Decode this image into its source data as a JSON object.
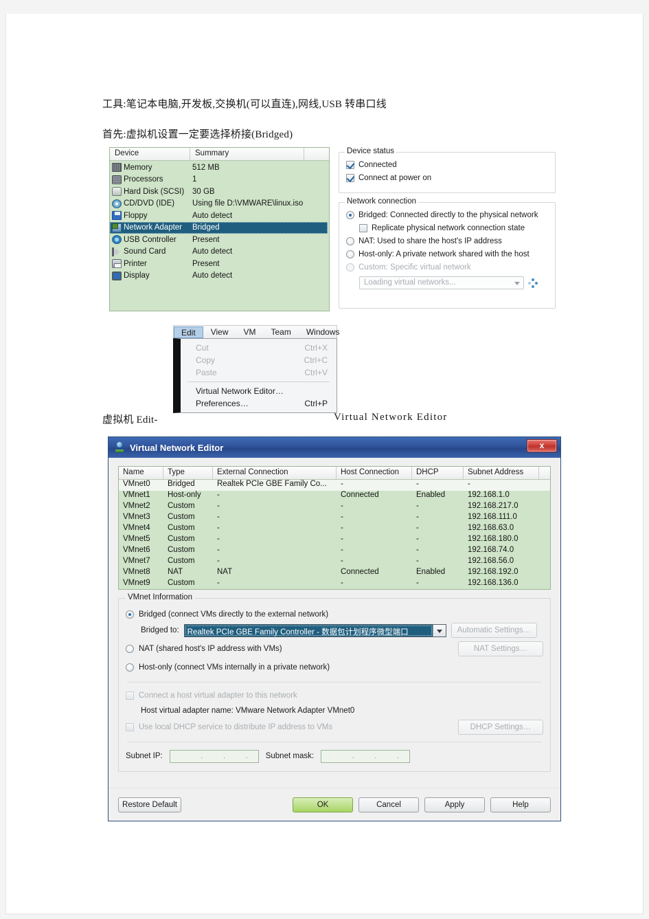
{
  "document": {
    "line1": "工具:笔记本电脑,开发板,交换机(可以直连),网线,USB 转串口线",
    "line2": "首先:虚拟机设置一定要选择桥接(Bridged)",
    "line3": "虚拟机 Edit-",
    "line4": "Virtual Network Editor"
  },
  "vm_settings": {
    "columns": [
      "Device",
      "Summary"
    ],
    "devices": [
      {
        "icon": "memory-icon",
        "name": "Memory",
        "summary": "512 MB",
        "selected": false
      },
      {
        "icon": "processor-icon",
        "name": "Processors",
        "summary": "1",
        "selected": false
      },
      {
        "icon": "hard-disk-icon",
        "name": "Hard Disk (SCSI)",
        "summary": "30 GB",
        "selected": false
      },
      {
        "icon": "cd-dvd-icon",
        "name": "CD/DVD (IDE)",
        "summary": "Using file D:\\VMWARE\\linux.iso",
        "selected": false
      },
      {
        "icon": "floppy-icon",
        "name": "Floppy",
        "summary": "Auto detect",
        "selected": false
      },
      {
        "icon": "network-adapter-icon",
        "name": "Network Adapter",
        "summary": "Bridged",
        "selected": true
      },
      {
        "icon": "usb-controller-icon",
        "name": "USB Controller",
        "summary": "Present",
        "selected": false
      },
      {
        "icon": "sound-card-icon",
        "name": "Sound Card",
        "summary": "Auto detect",
        "selected": false
      },
      {
        "icon": "printer-icon",
        "name": "Printer",
        "summary": "Present",
        "selected": false
      },
      {
        "icon": "display-icon",
        "name": "Display",
        "summary": "Auto detect",
        "selected": false
      }
    ],
    "device_status": {
      "title": "Device status",
      "connected": "Connected",
      "connect_at_power_on": "Connect at power on"
    },
    "network_connection": {
      "title": "Network connection",
      "bridged": "Bridged: Connected directly to the physical network",
      "replicate": "Replicate physical network connection state",
      "nat": "NAT: Used to share the host's IP address",
      "host_only": "Host-only: A private network shared with the host",
      "custom": "Custom: Specific virtual network",
      "custom_combo_placeholder": "Loading virtual networks..."
    }
  },
  "edit_menu": {
    "menubar": [
      "Edit",
      "View",
      "VM",
      "Team",
      "Windows"
    ],
    "items": [
      {
        "label": "Cut",
        "shortcut": "Ctrl+X",
        "disabled": true
      },
      {
        "label": "Copy",
        "shortcut": "Ctrl+C",
        "disabled": true
      },
      {
        "label": "Paste",
        "shortcut": "Ctrl+V",
        "disabled": true
      },
      {
        "label": "Virtual Network Editor…",
        "shortcut": "",
        "disabled": false
      },
      {
        "label": "Preferences…",
        "shortcut": "Ctrl+P",
        "disabled": false
      }
    ]
  },
  "virtual_network_editor": {
    "title": "Virtual Network Editor",
    "close_label": "x",
    "table": {
      "columns": [
        "Name",
        "Type",
        "External Connection",
        "Host Connection",
        "DHCP",
        "Subnet Address"
      ],
      "rows": [
        {
          "name": "VMnet0",
          "type": "Bridged",
          "external": "Realtek PCIe GBE Family Co...",
          "host": "-",
          "dhcp": "-",
          "subnet": "-",
          "selected": true
        },
        {
          "name": "VMnet1",
          "type": "Host-only",
          "external": "-",
          "host": "Connected",
          "dhcp": "Enabled",
          "subnet": "192.168.1.0",
          "selected": false
        },
        {
          "name": "VMnet2",
          "type": "Custom",
          "external": "-",
          "host": "-",
          "dhcp": "-",
          "subnet": "192.168.217.0",
          "selected": false
        },
        {
          "name": "VMnet3",
          "type": "Custom",
          "external": "-",
          "host": "-",
          "dhcp": "-",
          "subnet": "192.168.111.0",
          "selected": false
        },
        {
          "name": "VMnet4",
          "type": "Custom",
          "external": "-",
          "host": "-",
          "dhcp": "-",
          "subnet": "192.168.63.0",
          "selected": false
        },
        {
          "name": "VMnet5",
          "type": "Custom",
          "external": "-",
          "host": "-",
          "dhcp": "-",
          "subnet": "192.168.180.0",
          "selected": false
        },
        {
          "name": "VMnet6",
          "type": "Custom",
          "external": "-",
          "host": "-",
          "dhcp": "-",
          "subnet": "192.168.74.0",
          "selected": false
        },
        {
          "name": "VMnet7",
          "type": "Custom",
          "external": "-",
          "host": "-",
          "dhcp": "-",
          "subnet": "192.168.56.0",
          "selected": false
        },
        {
          "name": "VMnet8",
          "type": "NAT",
          "external": "NAT",
          "host": "Connected",
          "dhcp": "Enabled",
          "subnet": "192.168.192.0",
          "selected": false
        },
        {
          "name": "VMnet9",
          "type": "Custom",
          "external": "-",
          "host": "-",
          "dhcp": "-",
          "subnet": "192.168.136.0",
          "selected": false
        }
      ]
    },
    "info": {
      "title": "VMnet Information",
      "bridged_label": "Bridged (connect VMs directly to the external network)",
      "bridged_to_label": "Bridged to:",
      "bridged_to_value": "Realtek PCIe GBE Family Controller - 数据包计划程序微型端口",
      "automatic_settings": "Automatic Settings…",
      "nat_label": "NAT (shared host's IP address with VMs)",
      "nat_settings": "NAT Settings…",
      "host_only_label": "Host-only (connect VMs internally in a private network)",
      "connect_host_adapter": "Connect a host virtual adapter to this network",
      "host_adapter_name": "Host virtual adapter name: VMware Network Adapter VMnet0",
      "use_local_dhcp": "Use local DHCP service to distribute IP address to VMs",
      "dhcp_settings": "DHCP Settings…",
      "subnet_ip_label": "Subnet IP:",
      "subnet_ip_value": "",
      "subnet_mask_label": "Subnet mask:",
      "subnet_mask_value": ""
    },
    "footer": {
      "restore_default": "Restore Default",
      "ok": "OK",
      "cancel": "Cancel",
      "apply": "Apply",
      "help": "Help"
    }
  },
  "colors": {
    "panel_green": "#cfe4c8",
    "selection_blue": "#1f5e7e",
    "titlebar_blue": "#2f539a",
    "ok_green": "#a8d466",
    "close_red": "#c93b33"
  }
}
